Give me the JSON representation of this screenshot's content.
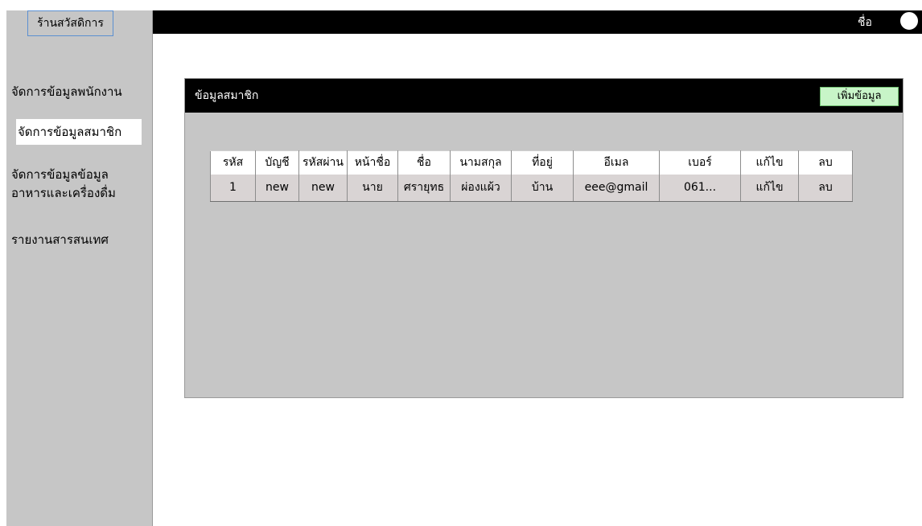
{
  "sidebar": {
    "brand": "ร้านสวัสดิการ",
    "items": [
      {
        "label": "จัดการข้อมูลพนักงาน"
      },
      {
        "label": "จัดการข้อมูลสมาชิก",
        "active": true
      },
      {
        "label": "จัดการข้อมูลข้อมูล"
      },
      {
        "label": "อาหารและเครื่องดื่ม"
      },
      {
        "label": "รายงานสารสนเทศ"
      }
    ]
  },
  "header": {
    "user_name": "ชื่อ"
  },
  "panel": {
    "title": "ข้อมูลสมาชิก",
    "add_button": "เพิ่มข้อมูล",
    "columns": [
      "รหัส",
      "บัญชี",
      "รหัสผ่าน",
      "หน้าชื่อ",
      "ชื่อ",
      "นามสกุล",
      "ที่อยู่",
      "อีเมล",
      "เบอร์",
      "แก้ไข",
      "ลบ"
    ],
    "rows": [
      [
        "1",
        "new",
        "new",
        "นาย",
        "ศรายุทธ",
        "ผ่องแผ้ว",
        "บ้าน",
        "eee@gmail",
        "061...",
        "แก้ไข",
        "ลบ"
      ]
    ]
  },
  "colors": {
    "sidebar_bg": "#c6c6c6",
    "topbar_bg": "#000000",
    "add_button_bg": "#c8f5c8",
    "row_bg": "#d9d4d4"
  }
}
